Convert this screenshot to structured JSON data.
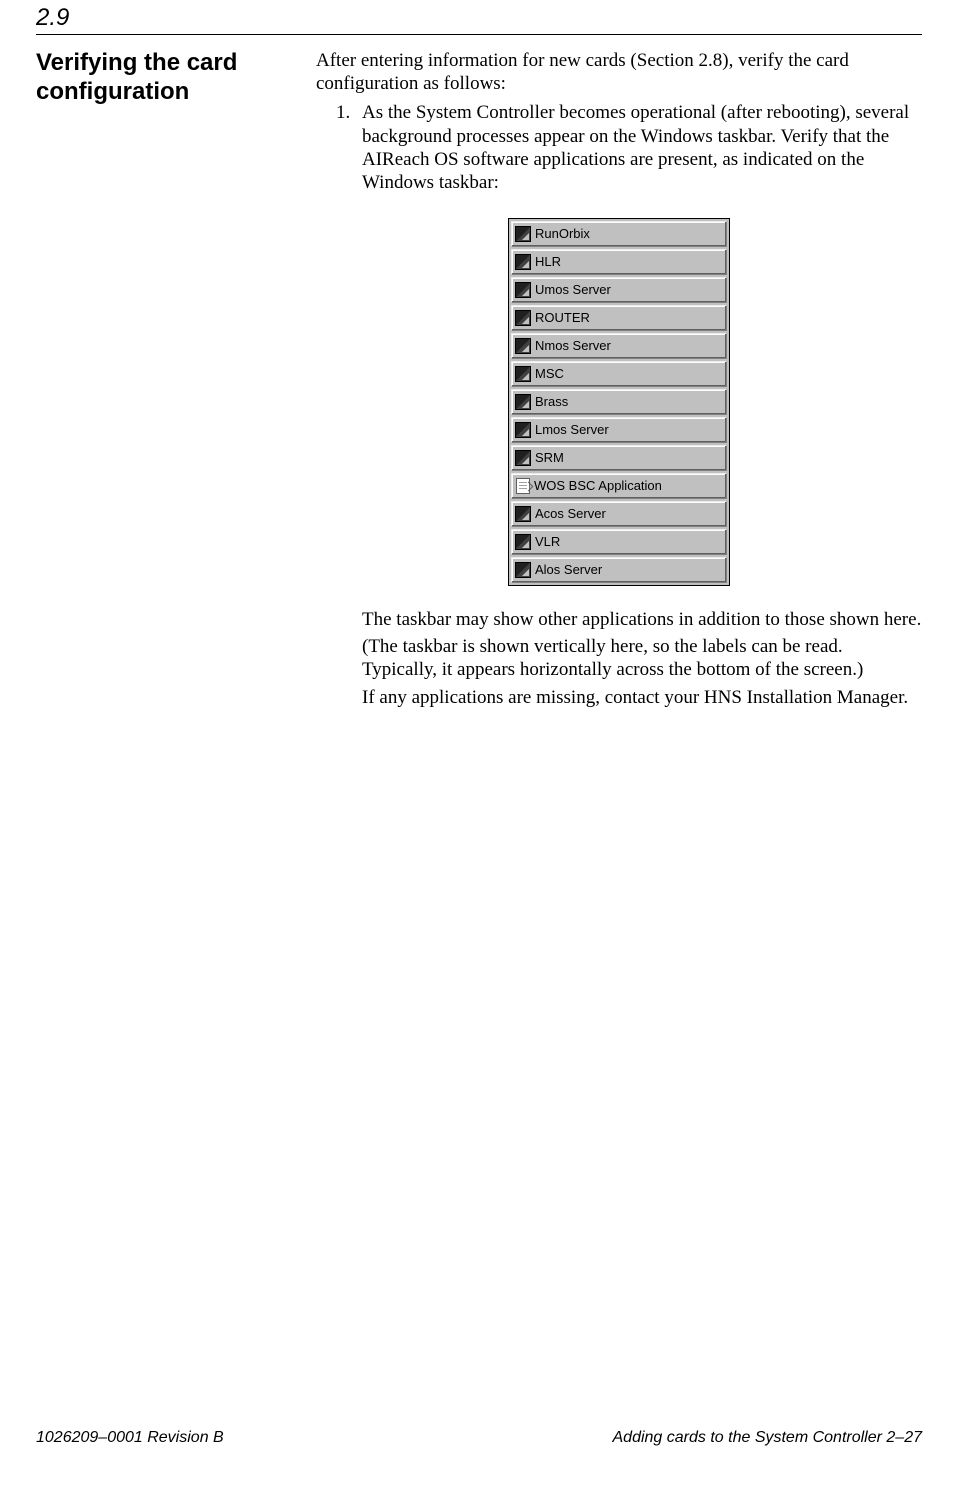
{
  "section_number": "2.9",
  "left_title": "Verifying the card configuration",
  "intro": "After entering information for new cards (Section 2.8), verify the card configuration as follows:",
  "step_num": "1.",
  "step_text": "As the System Controller becomes operational (after rebooting), several background processes appear on the Windows taskbar. Verify that the AIReach OS software applications are present, as indicated on the Windows taskbar:",
  "taskbar_items": {
    "i0": "RunOrbix",
    "i1": "HLR",
    "i2": "Umos Server",
    "i3": "ROUTER",
    "i4": "Nmos Server",
    "i5": "MSC",
    "i6": "Brass",
    "i7": "Lmos Server",
    "i8": "SRM",
    "i9": "WOS BSC Application",
    "i10": "Acos Server",
    "i11": "VLR",
    "i12": "Alos Server"
  },
  "after": {
    "p1": "The taskbar may show other applications in addition to those shown here.",
    "p2": "(The taskbar is shown vertically here, so the labels can be read. Typically, it appears horizontally across the bottom of the screen.)",
    "p3": "If any applications are missing, contact your HNS Installation Manager."
  },
  "footer": {
    "left": "1026209–0001  Revision B",
    "right": "Adding cards to the System Controller   2–27"
  }
}
